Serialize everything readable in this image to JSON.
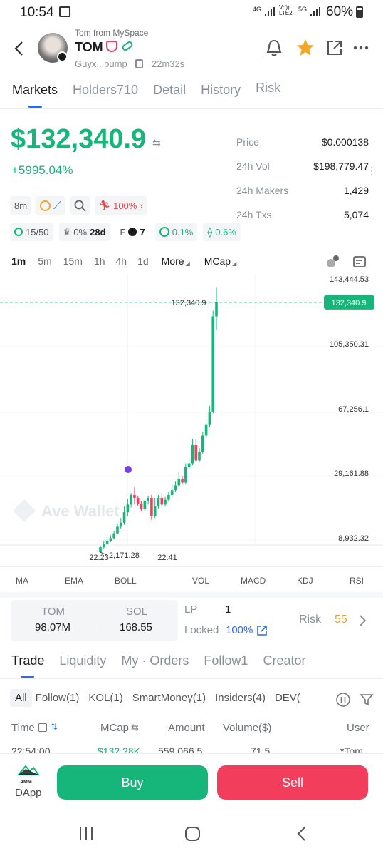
{
  "status_bar": {
    "time": "10:54",
    "net1": "4G",
    "net2": "Vo)) LTE2",
    "net3": "5G",
    "battery": "60%"
  },
  "header": {
    "subtitle": "Tom from MySpace",
    "token_name": "TOM",
    "address": "Guyx...pump",
    "age": "22m32s"
  },
  "tabs": [
    {
      "label": "Markets"
    },
    {
      "label": "Holders710"
    },
    {
      "label": "Detail"
    },
    {
      "label": "History"
    },
    {
      "label": "Risk"
    }
  ],
  "price_panel": {
    "big_value": "$132,340.9",
    "change": "+5995.04%",
    "stats": [
      {
        "label": "Price",
        "value": "$0.000138"
      },
      {
        "label": "24h Vol",
        "value": "$198,779.47"
      },
      {
        "label": "24h Makers",
        "value": "1,429"
      },
      {
        "label": "24h Txs",
        "value": "5,074"
      }
    ]
  },
  "chips_row1": {
    "age": "8m",
    "rank": "100%"
  },
  "chips_row2": {
    "holders": "15/50",
    "tax": "0%",
    "days": "28d",
    "f_label": "F",
    "f_value": "7",
    "c1": "0.1%",
    "c2": "0.6%"
  },
  "timeframes": {
    "items": [
      "1m",
      "5m",
      "15m",
      "1h",
      "4h",
      "1d"
    ],
    "more": "More",
    "mcap": "MCap"
  },
  "chart_data": {
    "type": "candlestick",
    "y_axis_labels": [
      "143,444.53",
      "105,350.31",
      "67,256.1",
      "29,161.88",
      "8,932.32"
    ],
    "current_label": "132,340.9",
    "current_badge": "132,340.9",
    "low_label": "2,171.28",
    "x_axis_labels": [
      "22:23",
      "22:41"
    ],
    "watermark": "Ave Wallet",
    "ylim": [
      0,
      150000
    ],
    "candles": [
      {
        "o": 2200,
        "c": 4800,
        "h": 5500,
        "l": 2171
      },
      {
        "o": 4800,
        "c": 6500,
        "h": 8000,
        "l": 4000
      },
      {
        "o": 6500,
        "c": 8200,
        "h": 9800,
        "l": 6000
      },
      {
        "o": 8200,
        "c": 9500,
        "h": 11000,
        "l": 7500
      },
      {
        "o": 9500,
        "c": 12000,
        "h": 13500,
        "l": 9000
      },
      {
        "o": 12000,
        "c": 15500,
        "h": 17000,
        "l": 11500
      },
      {
        "o": 15500,
        "c": 17500,
        "h": 20000,
        "l": 14500
      },
      {
        "o": 17500,
        "c": 23000,
        "h": 26000,
        "l": 16500
      },
      {
        "o": 23000,
        "c": 27000,
        "h": 30000,
        "l": 21000
      },
      {
        "o": 27000,
        "c": 32000,
        "h": 33000,
        "l": 25500
      },
      {
        "o": 32000,
        "c": 30500,
        "h": 36000,
        "l": 27000
      },
      {
        "o": 30500,
        "c": 27500,
        "h": 31500,
        "l": 26000
      },
      {
        "o": 27500,
        "c": 24500,
        "h": 29000,
        "l": 23500
      },
      {
        "o": 24500,
        "c": 29000,
        "h": 30000,
        "l": 23500
      },
      {
        "o": 29000,
        "c": 30500,
        "h": 31500,
        "l": 27000
      },
      {
        "o": 30500,
        "c": 21000,
        "h": 32000,
        "l": 19000
      },
      {
        "o": 21000,
        "c": 26000,
        "h": 30500,
        "l": 20000
      },
      {
        "o": 26000,
        "c": 30500,
        "h": 32000,
        "l": 25000
      },
      {
        "o": 30500,
        "c": 27000,
        "h": 33000,
        "l": 25500
      },
      {
        "o": 27000,
        "c": 29500,
        "h": 31000,
        "l": 26000
      },
      {
        "o": 29500,
        "c": 32000,
        "h": 33500,
        "l": 28500
      },
      {
        "o": 32000,
        "c": 34500,
        "h": 38000,
        "l": 31000
      },
      {
        "o": 34500,
        "c": 37000,
        "h": 39000,
        "l": 33500
      },
      {
        "o": 37000,
        "c": 40500,
        "h": 44000,
        "l": 36000
      },
      {
        "o": 40500,
        "c": 38500,
        "h": 42000,
        "l": 37500
      },
      {
        "o": 38500,
        "c": 46500,
        "h": 48500,
        "l": 37500
      },
      {
        "o": 46500,
        "c": 48500,
        "h": 51500,
        "l": 45500
      },
      {
        "o": 48500,
        "c": 58000,
        "h": 61000,
        "l": 47500
      },
      {
        "o": 58000,
        "c": 50000,
        "h": 61000,
        "l": 49000
      },
      {
        "o": 50000,
        "c": 54500,
        "h": 56500,
        "l": 49000
      },
      {
        "o": 54500,
        "c": 63000,
        "h": 65000,
        "l": 53500
      },
      {
        "o": 63000,
        "c": 68500,
        "h": 71500,
        "l": 61000
      },
      {
        "o": 68500,
        "c": 75500,
        "h": 78500,
        "l": 67500
      },
      {
        "o": 75500,
        "c": 125000,
        "h": 128000,
        "l": 74500
      },
      {
        "o": 125000,
        "c": 132340,
        "h": 140000,
        "l": 118000
      }
    ]
  },
  "indicators": [
    "MA",
    "EMA",
    "BOLL",
    "VOL",
    "MACD",
    "KDJ",
    "RSI"
  ],
  "liquidity": {
    "tom_label": "TOM",
    "tom_value": "98.07M",
    "sol_label": "SOL",
    "sol_value": "168.55",
    "lp_label": "LP",
    "lp_value": "1",
    "locked_label": "Locked",
    "locked_value": "100%",
    "risk_label": "Risk",
    "risk_value": "55"
  },
  "trade_tabs": [
    {
      "label": "Trade"
    },
    {
      "label": "Liquidity"
    },
    {
      "label": "My · Orders"
    },
    {
      "label": "Follow1"
    },
    {
      "label": "Creator"
    }
  ],
  "filters": [
    "All",
    "Follow(1)",
    "KOL(1)",
    "SmartMoney(1)",
    "Insiders(4)",
    "DEV("
  ],
  "columns": [
    "Time",
    "MCap",
    "Amount",
    "Volume($)",
    "User"
  ],
  "partial_row": [
    "22:54:00",
    "$132.28K",
    "559,066.5",
    "71.5",
    "*Tom"
  ],
  "bottom": {
    "dapp_label": "DApp",
    "dapp_logo": "AMM",
    "buy_label": "Buy",
    "sell_label": "Sell"
  },
  "colors": {
    "green": "#16b67a",
    "red": "#e5484d",
    "pink": "#f23d5c",
    "accent_blue": "#2f6bdf",
    "star": "#f5a623",
    "risk": "#e9a23b"
  }
}
